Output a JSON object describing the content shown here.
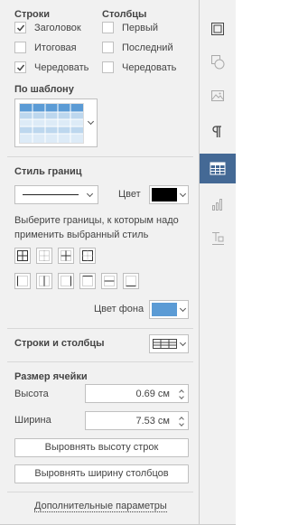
{
  "rows_section": {
    "title": "Строки",
    "items": [
      {
        "label": "Заголовок",
        "checked": true
      },
      {
        "label": "Итоговая",
        "checked": false
      },
      {
        "label": "Чередовать",
        "checked": true
      }
    ]
  },
  "cols_section": {
    "title": "Столбцы",
    "items": [
      {
        "label": "Первый",
        "checked": false
      },
      {
        "label": "Последний",
        "checked": false
      },
      {
        "label": "Чередовать",
        "checked": false
      }
    ]
  },
  "template": {
    "title": "По шаблону"
  },
  "borders": {
    "title": "Стиль границ",
    "color_label": "Цвет",
    "border_color": "#000000",
    "hint": "Выберите границы, к которым надо применить выбранный стиль",
    "bg_label": "Цвет фона",
    "bg_color": "#5b9bd5"
  },
  "rows_cols": {
    "title": "Строки и столбцы"
  },
  "cell_size": {
    "title": "Размер ячейки",
    "height_label": "Высота",
    "height_value": "0.69 см",
    "width_label": "Ширина",
    "width_value": "7.53 см"
  },
  "buttons": {
    "distribute_rows": "Выровнять высоту строк",
    "distribute_cols": "Выровнять ширину столбцов"
  },
  "advanced_link": "Дополнительные параметры",
  "sidebar": {
    "icons": [
      "slide-icon",
      "shape-icon",
      "image-icon",
      "paragraph-icon",
      "table-icon",
      "chart-icon",
      "text-art-icon"
    ],
    "active": "table-icon",
    "active_color": "#446995"
  }
}
